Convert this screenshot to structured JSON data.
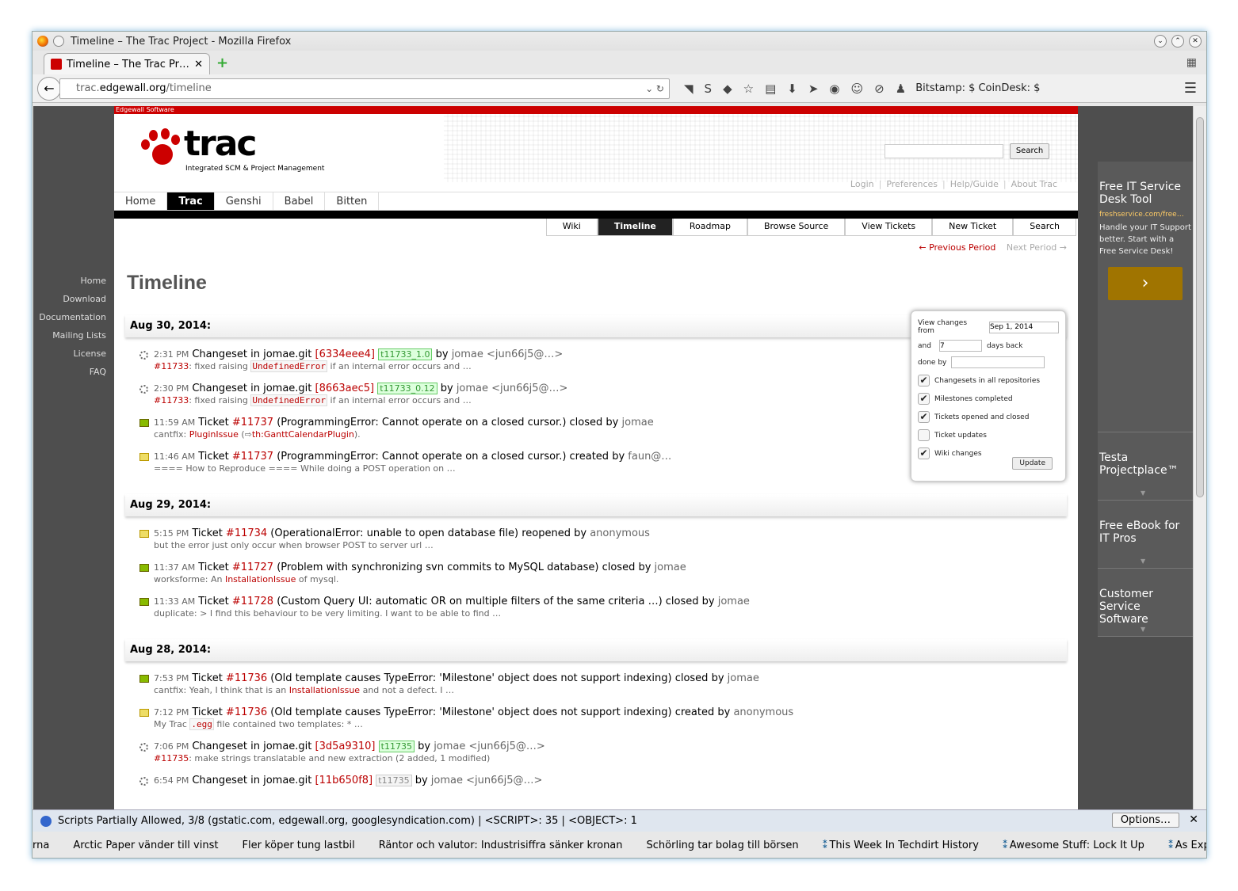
{
  "window": {
    "title": "Timeline – The Trac Project - Mozilla Firefox",
    "tab_title": "Timeline – The Trac Pr…"
  },
  "urlbar": {
    "host": "trac.edgewall.org",
    "host_pre": "trac.",
    "host_main": "edgewall.org",
    "path": "/timeline"
  },
  "toolbar": {
    "bitstamp": "Bitstamp: $ CoinDesk: $"
  },
  "sidebar": {
    "items": [
      "Home",
      "Download",
      "Documentation",
      "Mailing Lists",
      "License",
      "FAQ"
    ]
  },
  "banner": {
    "company": "Edgewall Software"
  },
  "logo": {
    "word": "trac",
    "tagline": "Integrated SCM & Project Management"
  },
  "search": {
    "button": "Search"
  },
  "meta": {
    "items": [
      "Login",
      "Preferences",
      "Help/Guide",
      "About Trac"
    ]
  },
  "projtabs": [
    "Home",
    "Trac",
    "Genshi",
    "Babel",
    "Bitten"
  ],
  "mainnav": [
    "Wiki",
    "Timeline",
    "Roadmap",
    "Browse Source",
    "View Tickets",
    "New Ticket",
    "Search"
  ],
  "periods": {
    "prev": "← Previous Period",
    "next": "Next Period →"
  },
  "page": {
    "title": "Timeline"
  },
  "days": [
    {
      "date": "Aug 30, 2014:",
      "events": [
        {
          "kind": "changeset",
          "time": "2:31 PM",
          "pre": "Changeset in jomae.git ",
          "ref": "[6334eee4]",
          "tag": "t11733_1.0",
          "tag_style": "green",
          "post": " by ",
          "author": "jomae <jun66j5@…>",
          "desc": [
            {
              "t": "red",
              "v": "#11733"
            },
            {
              "t": "txt",
              "v": ": fixed raising "
            },
            {
              "t": "code",
              "v": "UndefinedError"
            },
            {
              "t": "txt",
              "v": " if an internal error occurs and …"
            }
          ]
        },
        {
          "kind": "changeset",
          "time": "2:30 PM",
          "pre": "Changeset in jomae.git ",
          "ref": "[8663aec5]",
          "tag": "t11733_0.12",
          "tag_style": "green",
          "post": " by ",
          "author": "jomae <jun66j5@…>",
          "desc": [
            {
              "t": "red",
              "v": "#11733"
            },
            {
              "t": "txt",
              "v": ": fixed raising "
            },
            {
              "t": "code",
              "v": "UndefinedError"
            },
            {
              "t": "txt",
              "v": " if an internal error occurs and …"
            }
          ]
        },
        {
          "kind": "closed",
          "time": "11:59 AM",
          "pre": "Ticket ",
          "ref": "#11737",
          "tag": "",
          "post": " (ProgrammingError: Cannot operate on a closed cursor.) closed by ",
          "author": "jomae",
          "desc": [
            {
              "t": "txt",
              "v": "cantfix: "
            },
            {
              "t": "red",
              "v": "PluginIssue"
            },
            {
              "t": "txt",
              "v": " (⇨"
            },
            {
              "t": "red",
              "v": "th:GanttCalendarPlugin"
            },
            {
              "t": "txt",
              "v": ")."
            }
          ]
        },
        {
          "kind": "opened",
          "time": "11:46 AM",
          "pre": "Ticket ",
          "ref": "#11737",
          "tag": "",
          "post": " (ProgrammingError: Cannot operate on a closed cursor.) created by ",
          "author": "faun@…",
          "desc": [
            {
              "t": "txt",
              "v": "==== How to Reproduce ==== While doing a POST operation on …"
            }
          ]
        }
      ]
    },
    {
      "date": "Aug 29, 2014:",
      "events": [
        {
          "kind": "opened",
          "time": "5:15 PM",
          "pre": "Ticket ",
          "ref": "#11734",
          "tag": "",
          "post": " (OperationalError: unable to open database file) reopened by ",
          "author": "anonymous",
          "desc": [
            {
              "t": "txt",
              "v": "but the error just only occur when browser POST to server url …"
            }
          ]
        },
        {
          "kind": "closed",
          "time": "11:37 AM",
          "pre": "Ticket ",
          "ref": "#11727",
          "tag": "",
          "post": " (Problem with synchronizing svn commits to MySQL database) closed by ",
          "author": "jomae",
          "desc": [
            {
              "t": "txt",
              "v": "worksforme: An "
            },
            {
              "t": "red",
              "v": "InstallationIssue"
            },
            {
              "t": "txt",
              "v": " of mysql."
            }
          ]
        },
        {
          "kind": "closed",
          "time": "11:33 AM",
          "pre": "Ticket ",
          "ref": "#11728",
          "tag": "",
          "post": " (Custom Query UI: automatic OR on multiple filters of the same criteria …) closed by ",
          "author": "jomae",
          "desc": [
            {
              "t": "txt",
              "v": "duplicate: > I find this behaviour to be very limiting. I want to be able to find …"
            }
          ]
        }
      ]
    },
    {
      "date": "Aug 28, 2014:",
      "events": [
        {
          "kind": "closed",
          "time": "7:53 PM",
          "pre": "Ticket ",
          "ref": "#11736",
          "tag": "",
          "post": " (Old template causes TypeError: 'Milestone' object does not support indexing) closed by ",
          "author": "jomae",
          "desc": [
            {
              "t": "txt",
              "v": "cantfix: Yeah, I think that is an "
            },
            {
              "t": "red",
              "v": "InstallationIssue"
            },
            {
              "t": "txt",
              "v": " and not a defect. I …"
            }
          ]
        },
        {
          "kind": "opened",
          "time": "7:12 PM",
          "pre": "Ticket ",
          "ref": "#11736",
          "tag": "",
          "post": " (Old template causes TypeError: 'Milestone' object does not support indexing) created by ",
          "author": "anonymous",
          "desc": [
            {
              "t": "txt",
              "v": "My Trac "
            },
            {
              "t": "code",
              "v": ".egg"
            },
            {
              "t": "txt",
              "v": " file contained two templates: * …"
            }
          ]
        },
        {
          "kind": "changeset",
          "time": "7:06 PM",
          "pre": "Changeset in jomae.git ",
          "ref": "[3d5a9310]",
          "tag": "t11735",
          "tag_style": "green",
          "post": " by ",
          "author": "jomae <jun66j5@…>",
          "desc": [
            {
              "t": "red",
              "v": "#11735"
            },
            {
              "t": "txt",
              "v": ": make strings translatable and new extraction (2 added, 1 modified)"
            }
          ]
        },
        {
          "kind": "changeset",
          "time": "6:54 PM",
          "pre": "Changeset in jomae.git ",
          "ref": "[11b650f8]",
          "tag": "t11735",
          "tag_style": "gray",
          "post": " by ",
          "author": "jomae <jun66j5@…>",
          "desc": []
        }
      ]
    }
  ],
  "filter": {
    "from_label": "View changes from",
    "from_value": "Sep 1, 2014",
    "and_label": "and",
    "days_value": "7",
    "days_label": "days back",
    "done_label": "done by",
    "done_value": "",
    "options": [
      {
        "label": "Changesets in all repositories",
        "checked": true
      },
      {
        "label": "Milestones completed",
        "checked": true
      },
      {
        "label": "Tickets opened and closed",
        "checked": true
      },
      {
        "label": "Ticket updates",
        "checked": false
      },
      {
        "label": "Wiki changes",
        "checked": true
      }
    ],
    "update": "Update"
  },
  "ads": [
    {
      "title": "Free IT Service Desk Tool",
      "url": "freshservice.com/free…",
      "text": "Handle your IT Support better. Start with a Free Service Desk!",
      "go": "›"
    },
    {
      "title": "Testa Projectplace™"
    },
    {
      "title": "Free eBook for IT Pros"
    },
    {
      "title": "Customer Service Software"
    }
  ],
  "statusbar": {
    "text": "Scripts Partially Allowed, 3/8 (gstatic.com, edgewall.org, googlesyndication.com) | <SCRIPT>: 35 | <OBJECT>: 1",
    "options": "Options…",
    "close": "✕"
  },
  "news": [
    "rna",
    "Arctic Paper vänder till vinst",
    "Fler köper tung lastbil",
    "Räntor och valutor: Industrisiffra sänker kronan",
    "Schörling tar bolag till börsen",
    "This Week In Techdirt History",
    "Awesome Stuff: Lock It Up",
    "As Expected, Aereo Plead"
  ]
}
